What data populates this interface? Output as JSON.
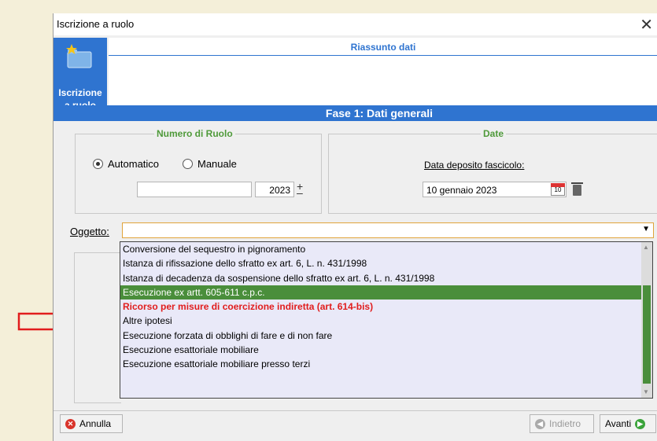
{
  "window": {
    "title": "Iscrizione a ruolo"
  },
  "sidebar": {
    "button_line1": "Iscrizione",
    "button_line2": "a ruolo",
    "icon": "folder-star-icon"
  },
  "header": {
    "subtitle": "Riassunto dati"
  },
  "phase": {
    "title": "Fase 1: Dati generali"
  },
  "numero_ruolo": {
    "legend": "Numero di Ruolo",
    "radio_auto": "Automatico",
    "radio_manual": "Manuale",
    "selected": "Automatico",
    "number_value": "",
    "year_value": "2023"
  },
  "date": {
    "legend": "Date",
    "deposit_label": "Data deposito fascicolo:",
    "deposit_value": "10 gennaio 2023",
    "calendar_day": "10"
  },
  "oggetto": {
    "label": "Oggetto:",
    "value": "",
    "options": [
      "Conversione del sequestro in pignoramento",
      "Istanza di rifissazione dello sfratto ex art. 6, L. n. 431/1998",
      "Istanza di decadenza da sospensione dello sfratto ex art. 6, L. n. 431/1998",
      "Esecuzione ex artt. 605-611 c.p.c.",
      "Ricorso per misure di coercizione indiretta (art. 614-bis)",
      "Altre ipotesi",
      "Esecuzione forzata di obblighi di fare e di non fare",
      "Esecuzione esattoriale mobiliare",
      "Esecuzione esattoriale mobiliare presso terzi"
    ],
    "selected_index": 3,
    "highlighted_index": 4
  },
  "footer": {
    "cancel": "Annulla",
    "back": "Indietro",
    "next": "Avanti"
  },
  "colors": {
    "accent": "#2f74d0",
    "selection": "#4a8e3b",
    "highlight": "#e11d1d"
  }
}
